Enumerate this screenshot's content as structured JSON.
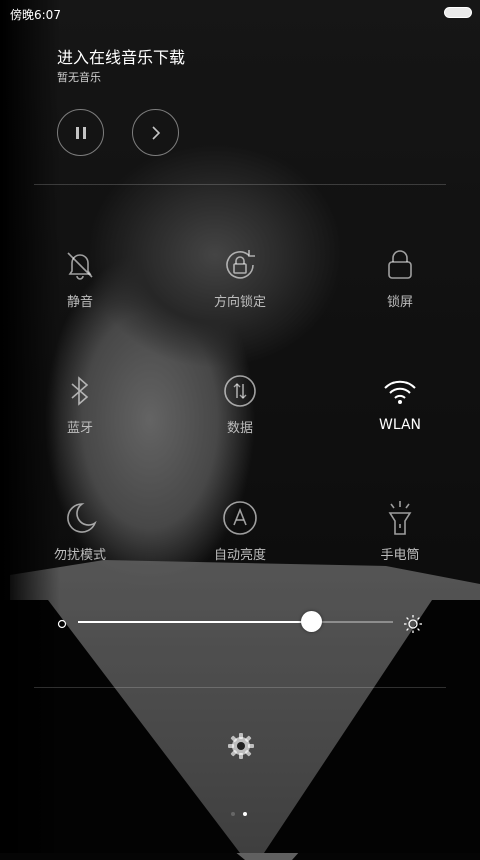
{
  "status_bar": {
    "time": "傍晚6:07"
  },
  "music": {
    "title": "进入在线音乐下载",
    "subtitle": "暂无音乐"
  },
  "media_controls": [
    {
      "name": "pause-button",
      "icon": "pause-icon"
    },
    {
      "name": "next-button",
      "icon": "chevron-right-icon"
    }
  ],
  "tiles": [
    {
      "label": "静音",
      "icon": "bell-muted-icon",
      "active": false
    },
    {
      "label": "方向锁定",
      "icon": "rotation-lock-icon",
      "active": false
    },
    {
      "label": "锁屏",
      "icon": "lock-icon",
      "active": false
    },
    {
      "label": "蓝牙",
      "icon": "bluetooth-icon",
      "active": false
    },
    {
      "label": "数据",
      "icon": "mobile-data-icon",
      "active": false
    },
    {
      "label": "WLAN",
      "icon": "wifi-icon",
      "active": true
    },
    {
      "label": "勿扰模式",
      "icon": "moon-icon",
      "active": false
    },
    {
      "label": "自动亮度",
      "icon": "auto-brightness-icon",
      "active": false
    },
    {
      "label": "手电筒",
      "icon": "flashlight-icon",
      "active": false
    }
  ],
  "brightness": {
    "level": 0.74
  },
  "page_indicator": {
    "count": 2,
    "active_index": 1
  },
  "colors": {
    "active": "#ffffff",
    "inactive": "#bdbdbd"
  }
}
